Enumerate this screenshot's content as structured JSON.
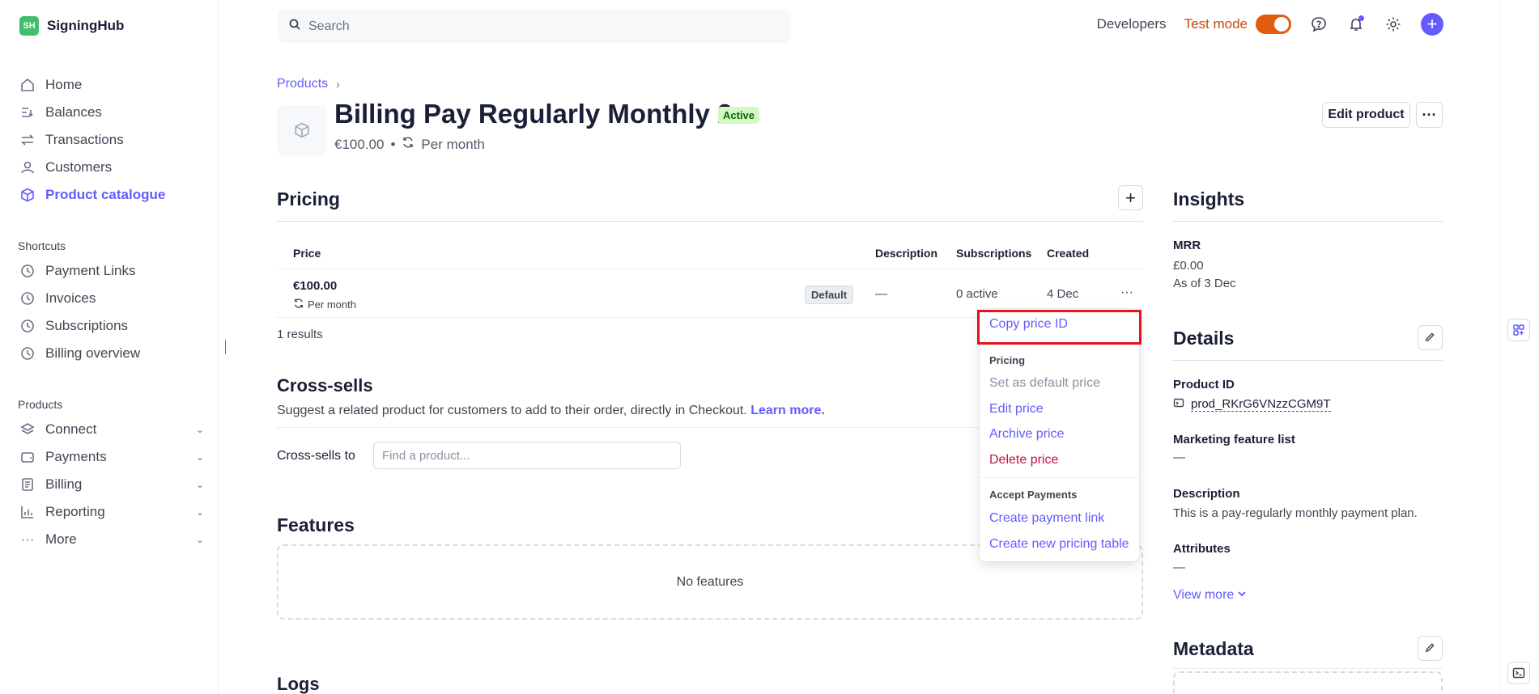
{
  "brand": {
    "logo_text": "SH",
    "name": "SigningHub"
  },
  "sidebar": {
    "main_items": [
      {
        "label": "Home",
        "icon": "home-icon"
      },
      {
        "label": "Balances",
        "icon": "balances-icon"
      },
      {
        "label": "Transactions",
        "icon": "transactions-icon"
      },
      {
        "label": "Customers",
        "icon": "customers-icon"
      },
      {
        "label": "Product catalogue",
        "icon": "product-icon",
        "active": true
      }
    ],
    "shortcuts_title": "Shortcuts",
    "shortcuts": [
      {
        "label": "Payment Links",
        "icon": "clock-icon"
      },
      {
        "label": "Invoices",
        "icon": "clock-icon"
      },
      {
        "label": "Subscriptions",
        "icon": "clock-icon"
      },
      {
        "label": "Billing overview",
        "icon": "clock-icon"
      }
    ],
    "products_title": "Products",
    "products": [
      {
        "label": "Connect",
        "icon": "connect-icon"
      },
      {
        "label": "Payments",
        "icon": "wallet-icon"
      },
      {
        "label": "Billing",
        "icon": "billing-icon"
      },
      {
        "label": "Reporting",
        "icon": "chart-icon"
      },
      {
        "label": "More",
        "icon": "more-dots-icon"
      }
    ]
  },
  "topbar": {
    "search_placeholder": "Search",
    "developers": "Developers",
    "test_mode": "Test mode"
  },
  "header": {
    "breadcrumb": "Products",
    "title": "Billing Pay Regularly Monthly 2",
    "status": "Active",
    "price": "€100.00",
    "bullet": "•",
    "interval": "Per month",
    "edit_button": "Edit product",
    "more_button": "···"
  },
  "pricing": {
    "title": "Pricing",
    "add_button": "+",
    "columns": {
      "price": "Price",
      "description": "Description",
      "subscriptions": "Subscriptions",
      "created": "Created"
    },
    "row": {
      "price": "€100.00",
      "interval": "Per month",
      "badge": "Default",
      "description": "—",
      "subscriptions": "0 active",
      "created": "4 Dec",
      "more": "···"
    },
    "results": "1 results"
  },
  "cross_sells": {
    "title": "Cross-sells",
    "description": "Suggest a related product for customers to add to their order, directly in Checkout.",
    "learn_more": "Learn more.",
    "label": "Cross-sells to",
    "input_placeholder": "Find a product..."
  },
  "features": {
    "title": "Features",
    "empty": "No features"
  },
  "logs": {
    "title": "Logs"
  },
  "insights": {
    "title": "Insights",
    "mrr_label": "MRR",
    "mrr_value": "£0.00",
    "as_of": "As of 3 Dec"
  },
  "details": {
    "title": "Details",
    "product_id_label": "Product ID",
    "product_id": "prod_RKrG6VNzzCGM9T",
    "marketing_label": "Marketing feature list",
    "marketing_value": "—",
    "description_label": "Description",
    "description_value": "This is a pay-regularly monthly payment plan.",
    "attributes_label": "Attributes",
    "attributes_value": "—",
    "view_more": "View more"
  },
  "metadata": {
    "title": "Metadata"
  },
  "menu": {
    "copy_price_id": "Copy price ID",
    "pricing_group": "Pricing",
    "set_default": "Set as default price",
    "edit_price": "Edit price",
    "archive_price": "Archive price",
    "delete_price": "Delete price",
    "accept_group": "Accept Payments",
    "create_payment_link": "Create payment link",
    "create_pricing_table": "Create new pricing table"
  },
  "colors": {
    "accent": "#635bff",
    "highlight": "#e8121d",
    "test_mode": "#c24a0c",
    "danger": "#c0123c"
  }
}
